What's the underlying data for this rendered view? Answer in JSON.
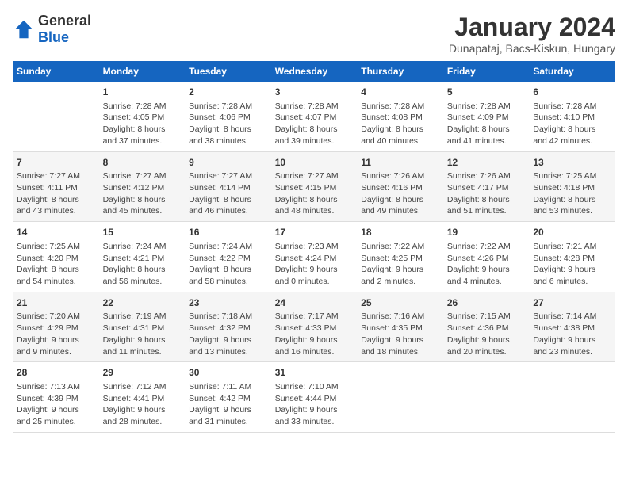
{
  "logo": {
    "text_general": "General",
    "text_blue": "Blue"
  },
  "header": {
    "title": "January 2024",
    "subtitle": "Dunapataj, Bacs-Kiskun, Hungary"
  },
  "weekdays": [
    "Sunday",
    "Monday",
    "Tuesday",
    "Wednesday",
    "Thursday",
    "Friday",
    "Saturday"
  ],
  "weeks": [
    [
      {
        "day": "",
        "sunrise": "",
        "sunset": "",
        "daylight": ""
      },
      {
        "day": "1",
        "sunrise": "Sunrise: 7:28 AM",
        "sunset": "Sunset: 4:05 PM",
        "daylight": "Daylight: 8 hours and 37 minutes."
      },
      {
        "day": "2",
        "sunrise": "Sunrise: 7:28 AM",
        "sunset": "Sunset: 4:06 PM",
        "daylight": "Daylight: 8 hours and 38 minutes."
      },
      {
        "day": "3",
        "sunrise": "Sunrise: 7:28 AM",
        "sunset": "Sunset: 4:07 PM",
        "daylight": "Daylight: 8 hours and 39 minutes."
      },
      {
        "day": "4",
        "sunrise": "Sunrise: 7:28 AM",
        "sunset": "Sunset: 4:08 PM",
        "daylight": "Daylight: 8 hours and 40 minutes."
      },
      {
        "day": "5",
        "sunrise": "Sunrise: 7:28 AM",
        "sunset": "Sunset: 4:09 PM",
        "daylight": "Daylight: 8 hours and 41 minutes."
      },
      {
        "day": "6",
        "sunrise": "Sunrise: 7:28 AM",
        "sunset": "Sunset: 4:10 PM",
        "daylight": "Daylight: 8 hours and 42 minutes."
      }
    ],
    [
      {
        "day": "7",
        "sunrise": "Sunrise: 7:27 AM",
        "sunset": "Sunset: 4:11 PM",
        "daylight": "Daylight: 8 hours and 43 minutes."
      },
      {
        "day": "8",
        "sunrise": "Sunrise: 7:27 AM",
        "sunset": "Sunset: 4:12 PM",
        "daylight": "Daylight: 8 hours and 45 minutes."
      },
      {
        "day": "9",
        "sunrise": "Sunrise: 7:27 AM",
        "sunset": "Sunset: 4:14 PM",
        "daylight": "Daylight: 8 hours and 46 minutes."
      },
      {
        "day": "10",
        "sunrise": "Sunrise: 7:27 AM",
        "sunset": "Sunset: 4:15 PM",
        "daylight": "Daylight: 8 hours and 48 minutes."
      },
      {
        "day": "11",
        "sunrise": "Sunrise: 7:26 AM",
        "sunset": "Sunset: 4:16 PM",
        "daylight": "Daylight: 8 hours and 49 minutes."
      },
      {
        "day": "12",
        "sunrise": "Sunrise: 7:26 AM",
        "sunset": "Sunset: 4:17 PM",
        "daylight": "Daylight: 8 hours and 51 minutes."
      },
      {
        "day": "13",
        "sunrise": "Sunrise: 7:25 AM",
        "sunset": "Sunset: 4:18 PM",
        "daylight": "Daylight: 8 hours and 53 minutes."
      }
    ],
    [
      {
        "day": "14",
        "sunrise": "Sunrise: 7:25 AM",
        "sunset": "Sunset: 4:20 PM",
        "daylight": "Daylight: 8 hours and 54 minutes."
      },
      {
        "day": "15",
        "sunrise": "Sunrise: 7:24 AM",
        "sunset": "Sunset: 4:21 PM",
        "daylight": "Daylight: 8 hours and 56 minutes."
      },
      {
        "day": "16",
        "sunrise": "Sunrise: 7:24 AM",
        "sunset": "Sunset: 4:22 PM",
        "daylight": "Daylight: 8 hours and 58 minutes."
      },
      {
        "day": "17",
        "sunrise": "Sunrise: 7:23 AM",
        "sunset": "Sunset: 4:24 PM",
        "daylight": "Daylight: 9 hours and 0 minutes."
      },
      {
        "day": "18",
        "sunrise": "Sunrise: 7:22 AM",
        "sunset": "Sunset: 4:25 PM",
        "daylight": "Daylight: 9 hours and 2 minutes."
      },
      {
        "day": "19",
        "sunrise": "Sunrise: 7:22 AM",
        "sunset": "Sunset: 4:26 PM",
        "daylight": "Daylight: 9 hours and 4 minutes."
      },
      {
        "day": "20",
        "sunrise": "Sunrise: 7:21 AM",
        "sunset": "Sunset: 4:28 PM",
        "daylight": "Daylight: 9 hours and 6 minutes."
      }
    ],
    [
      {
        "day": "21",
        "sunrise": "Sunrise: 7:20 AM",
        "sunset": "Sunset: 4:29 PM",
        "daylight": "Daylight: 9 hours and 9 minutes."
      },
      {
        "day": "22",
        "sunrise": "Sunrise: 7:19 AM",
        "sunset": "Sunset: 4:31 PM",
        "daylight": "Daylight: 9 hours and 11 minutes."
      },
      {
        "day": "23",
        "sunrise": "Sunrise: 7:18 AM",
        "sunset": "Sunset: 4:32 PM",
        "daylight": "Daylight: 9 hours and 13 minutes."
      },
      {
        "day": "24",
        "sunrise": "Sunrise: 7:17 AM",
        "sunset": "Sunset: 4:33 PM",
        "daylight": "Daylight: 9 hours and 16 minutes."
      },
      {
        "day": "25",
        "sunrise": "Sunrise: 7:16 AM",
        "sunset": "Sunset: 4:35 PM",
        "daylight": "Daylight: 9 hours and 18 minutes."
      },
      {
        "day": "26",
        "sunrise": "Sunrise: 7:15 AM",
        "sunset": "Sunset: 4:36 PM",
        "daylight": "Daylight: 9 hours and 20 minutes."
      },
      {
        "day": "27",
        "sunrise": "Sunrise: 7:14 AM",
        "sunset": "Sunset: 4:38 PM",
        "daylight": "Daylight: 9 hours and 23 minutes."
      }
    ],
    [
      {
        "day": "28",
        "sunrise": "Sunrise: 7:13 AM",
        "sunset": "Sunset: 4:39 PM",
        "daylight": "Daylight: 9 hours and 25 minutes."
      },
      {
        "day": "29",
        "sunrise": "Sunrise: 7:12 AM",
        "sunset": "Sunset: 4:41 PM",
        "daylight": "Daylight: 9 hours and 28 minutes."
      },
      {
        "day": "30",
        "sunrise": "Sunrise: 7:11 AM",
        "sunset": "Sunset: 4:42 PM",
        "daylight": "Daylight: 9 hours and 31 minutes."
      },
      {
        "day": "31",
        "sunrise": "Sunrise: 7:10 AM",
        "sunset": "Sunset: 4:44 PM",
        "daylight": "Daylight: 9 hours and 33 minutes."
      },
      {
        "day": "",
        "sunrise": "",
        "sunset": "",
        "daylight": ""
      },
      {
        "day": "",
        "sunrise": "",
        "sunset": "",
        "daylight": ""
      },
      {
        "day": "",
        "sunrise": "",
        "sunset": "",
        "daylight": ""
      }
    ]
  ]
}
